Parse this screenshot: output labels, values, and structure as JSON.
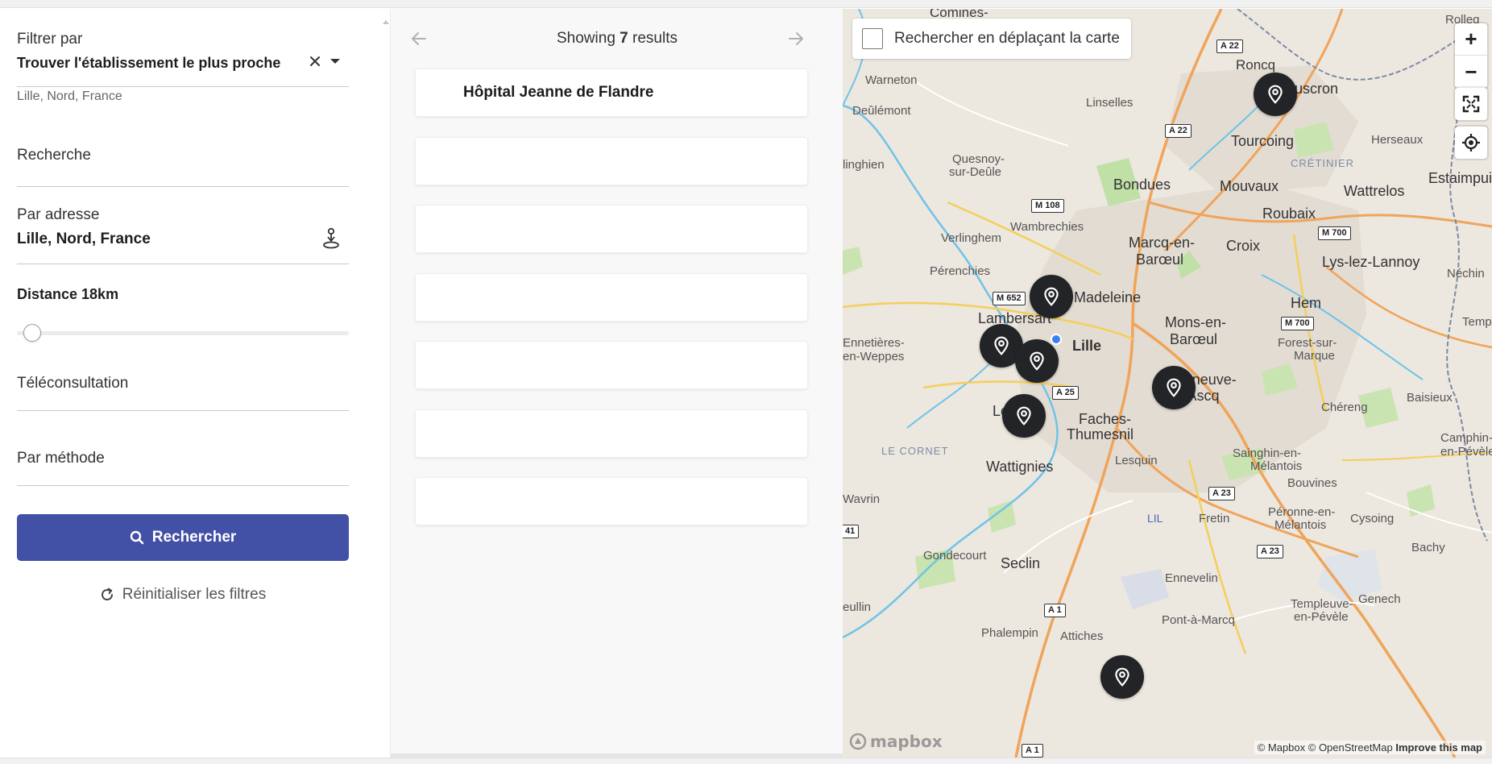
{
  "filters": {
    "filter_by_label": "Filtrer par",
    "filter_by_value": "Trouver l'établissement le plus proche",
    "location_hint": "Lille, Nord, France",
    "search_label": "Recherche",
    "address_label": "Par adresse",
    "address_value": "Lille, Nord, France",
    "distance_label": "Distance 18km",
    "distance_fraction": 0.02,
    "teleconsultation_label": "Téléconsultation",
    "method_label": "Par méthode",
    "search_button": "Rechercher",
    "reset_button": "Réinitialiser les filtres",
    "accent_color": "#4251a6"
  },
  "results": {
    "showing_prefix": "Showing",
    "count": "7",
    "showing_suffix": "results",
    "items": [
      {
        "name": "Hôpital Jeanne de Flandre"
      },
      {
        "name": ""
      },
      {
        "name": ""
      },
      {
        "name": ""
      },
      {
        "name": ""
      },
      {
        "name": ""
      },
      {
        "name": ""
      }
    ]
  },
  "map": {
    "search_on_move_label": "Rechercher en déplaçant la carte",
    "zoom_in": "+",
    "zoom_out": "−",
    "attribution_1": "© Mapbox © OpenStreetMap",
    "attribution_2": "Improve this map",
    "logo_text": "mapbox",
    "labels": {
      "comines": "Comines-",
      "rolleg": "Rolleg",
      "roncq": "Roncq",
      "mouscron": "Mouscron",
      "warneton": "Warneton",
      "deulemont": "Deûlémont",
      "linselles": "Linselles",
      "tourcoing": "Tourcoing",
      "herseaux": "Herseaux",
      "linghien": "linghien",
      "quesnoy": "Quesnoy-",
      "sur_deule": "sur-Deûle",
      "cretinier": "CRÉTINIER",
      "estaimpuis": "Estaimpuis",
      "bondues": "Bondues",
      "mouvaux": "Mouvaux",
      "wattrelos": "Wattrelos",
      "roubaix": "Roubaix",
      "wambrechies": "Wambrechies",
      "verlinghem": "Verlinghem",
      "marcq": "Marcq-en-",
      "baroeul": "Barœul",
      "croix": "Croix",
      "lys": "Lys-lez-Lannoy",
      "perenchies": "Pérenchies",
      "neuchin": "Néchin",
      "la_madeleine": "La Madeleine",
      "hem": "Hem",
      "lambersart": "Lambersart",
      "mons": "Mons-en-",
      "baroeul2": "Barœul",
      "temp": "Temp",
      "ennetieres": "Ennetières-",
      "en_weppes": "en-Weppes",
      "lille": "Lille",
      "forest": "Forest-sur-",
      "marque": "Marque",
      "villeneuve": "Villeneuve-",
      "dascq": "d'Ascq",
      "baisieux": "Baisieux",
      "loos": "Loos",
      "faches": "Faches-",
      "thumesnil": "Thumesnil",
      "chereng": "Chéreng",
      "le_cornet": "LE CORNET",
      "camphin": "Camphin-",
      "en_pevele": "en-Pévèle",
      "lesquin": "Lesquin",
      "sainghin": "Sainghin-en-",
      "melantois": "Mélantois",
      "wattignies": "Wattignies",
      "bouvines": "Bouvines",
      "wavrin": "Wavrin",
      "lil": "LIL",
      "fretin": "Fretin",
      "peronne": "Péronne-en-",
      "melantois2": "Mélantois",
      "cysoing": "Cysoing",
      "bachy": "Bachy",
      "gondecourt": "Gondecourt",
      "seclin": "Seclin",
      "ennevelin": "Ennevelin",
      "genech": "Genech",
      "templeuve": "Templeuve-",
      "en_pevele2": "en-Pévèle",
      "eullin": "eullin",
      "pont": "Pont-à-Marcq",
      "phalempin": "Phalempin",
      "attiches": "Attiches"
    },
    "roads": {
      "a22a": "A 22",
      "a22b": "A 22",
      "m108": "M 108",
      "m700a": "M 700",
      "m652": "M 652",
      "m700b": "M 700",
      "a25": "A 25",
      "a23a": "A 23",
      "a23b": "A 23",
      "a1a": "A 1",
      "a1b": "A 1",
      "n41": "41"
    }
  }
}
